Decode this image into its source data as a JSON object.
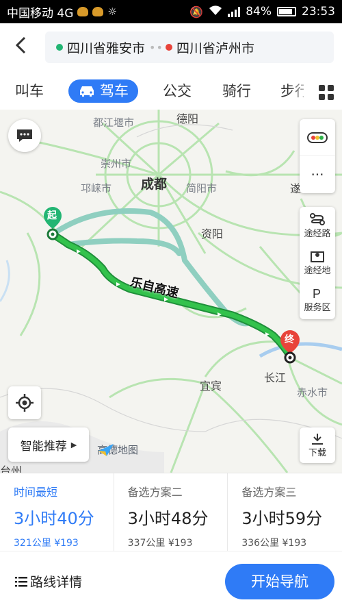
{
  "status_bar": {
    "carrier": "中国移动 4G",
    "battery": "84%",
    "time": "23:53"
  },
  "header": {
    "origin": "四川省雅安市",
    "destination": "四川省泸州市",
    "colors": {
      "origin": "#22b573",
      "destination": "#e8433a"
    }
  },
  "tabs": [
    "叫车",
    "驾车",
    "公交",
    "骑行",
    "步行"
  ],
  "active_tab": "驾车",
  "map": {
    "labels": {
      "dujiangyan": "都江堰市",
      "deyang": "德阳",
      "chongzhou": "崇州市",
      "chengdu": "成都",
      "qionglai": "邛崃市",
      "jianyang": "简阳市",
      "ziyang": "资阳",
      "sui": "遂",
      "leshan_hw": "乐自高速",
      "yibin": "宜宾",
      "changjiang": "长江",
      "chishui": "赤水市",
      "taizhou": "台州",
      "brand": "高德地图"
    },
    "start_label": "起",
    "end_label": "终",
    "route_color": "#2eb24a",
    "alt_route_color": "#8fcfc0"
  },
  "side_controls": {
    "waypoint_route": "途经路",
    "waypoint_place": "途经地",
    "service_area": "服务区",
    "download": "下载",
    "more": "···"
  },
  "smart_recommend": "智能推荐",
  "routes": [
    {
      "label": "时间最短",
      "time": "3小时40分",
      "distance": "321公里",
      "toll": "¥193",
      "active": true
    },
    {
      "label": "备选方案二",
      "time": "3小时48分",
      "distance": "337公里",
      "toll": "¥193",
      "active": false
    },
    {
      "label": "备选方案三",
      "time": "3小时59分",
      "distance": "336公里",
      "toll": "¥193",
      "active": false
    }
  ],
  "footer": {
    "route_detail": "路线详情",
    "start_navigation": "开始导航"
  },
  "accent": "#2f7bf6"
}
